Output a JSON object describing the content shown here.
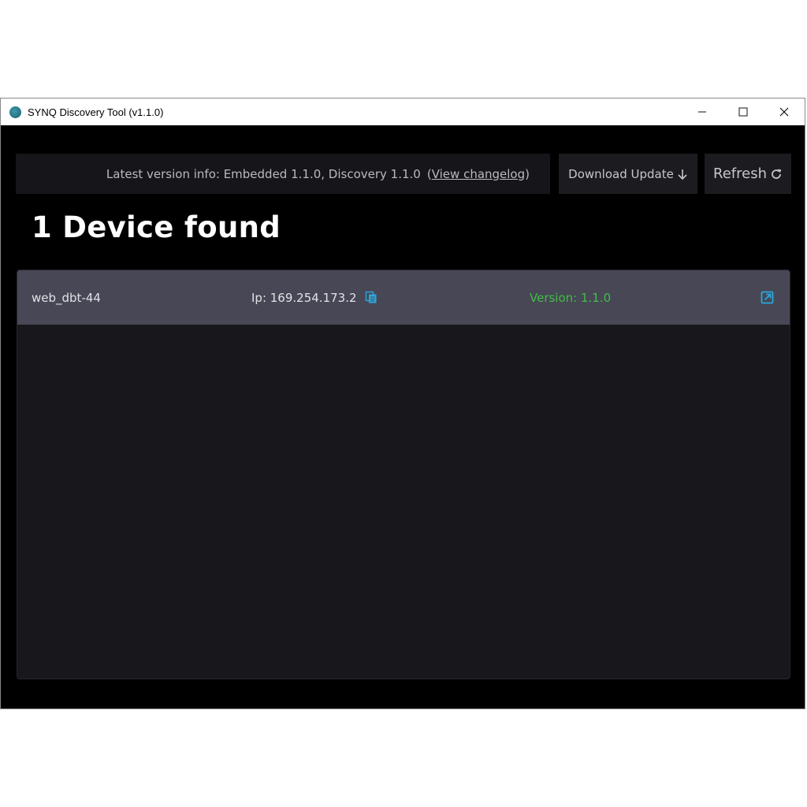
{
  "window": {
    "title": "SYNQ Discovery Tool (v1.1.0)",
    "controls": {
      "minimize": "–",
      "maximize": "☐",
      "close": "✕"
    }
  },
  "toolbar": {
    "version_info": "Latest version info: Embedded 1.1.0, Discovery 1.1.0",
    "changelog_link": "View changelog",
    "changelog_open": "(",
    "changelog_close": ")",
    "download_label": "Download Update",
    "refresh_label": "Refresh"
  },
  "main": {
    "heading": "1 Device found",
    "devices": [
      {
        "name": "web_dbt-44",
        "ip_label": "Ip: 169.254.173.2",
        "version_label": "Version: 1.1.0"
      }
    ]
  },
  "colors": {
    "accent_blue": "#29a8e0",
    "version_green": "#3fbf45",
    "row_bg": "#474755",
    "panel_bg": "#17171c"
  },
  "icons": {
    "app": "app-logo-icon",
    "download": "arrow-down-icon",
    "refresh": "refresh-icon",
    "copy": "copy-icon",
    "open": "external-link-icon"
  }
}
